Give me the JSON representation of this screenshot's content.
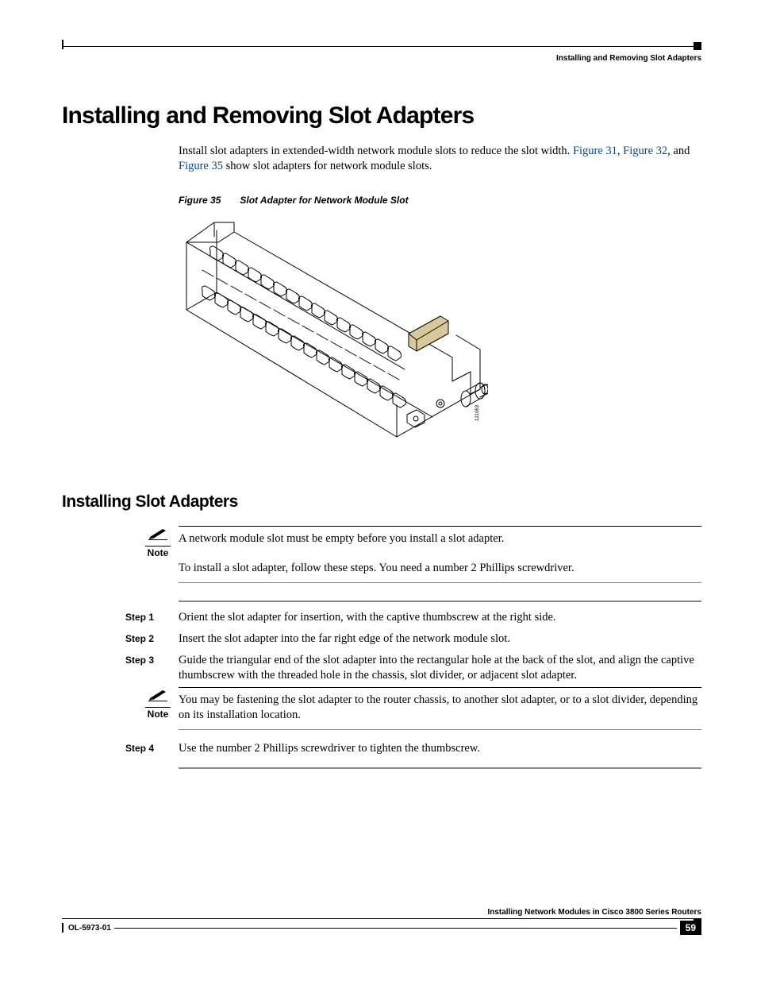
{
  "header": {
    "chapter": "Installing and Removing Slot Adapters"
  },
  "h1": "Installing and Removing Slot Adapters",
  "intro": {
    "t1": "Install slot adapters in extended-width network module slots to reduce the slot width. ",
    "link1": "Figure 31",
    "t2": ", ",
    "link2": "Figure 32",
    "t3": ", and ",
    "link3": "Figure 35",
    "t4": " show slot adapters for network module slots."
  },
  "figure": {
    "num": "Figure 35",
    "title": "Slot Adapter for Network Module Slot",
    "artnum": "121063"
  },
  "h2": "Installing Slot Adapters",
  "note1": {
    "label": "Note",
    "text": "A network module slot must be empty before you install a slot adapter."
  },
  "lead": "To install a slot adapter, follow these steps. You need a number 2 Phillips screwdriver.",
  "steps": {
    "s1": {
      "label": "Step 1",
      "text": "Orient the slot adapter for insertion, with the captive thumbscrew at the right side."
    },
    "s2": {
      "label": "Step 2",
      "text": "Insert the slot adapter into the far right edge of the network module slot."
    },
    "s3": {
      "label": "Step 3",
      "text": "Guide the triangular end of the slot adapter into the rectangular hole at the back of the slot, and align the captive thumbscrew with the threaded hole in the chassis, slot divider, or adjacent slot adapter."
    },
    "s4": {
      "label": "Step 4",
      "text": "Use the number 2 Phillips screwdriver to tighten the thumbscrew."
    }
  },
  "note2": {
    "label": "Note",
    "text": "You may be fastening the slot adapter to the router chassis, to another slot adapter, or to a slot divider, depending on its installation location."
  },
  "footer": {
    "title": "Installing Network Modules in Cisco 3800 Series Routers",
    "doc": "OL-5973-01",
    "page": "59"
  }
}
